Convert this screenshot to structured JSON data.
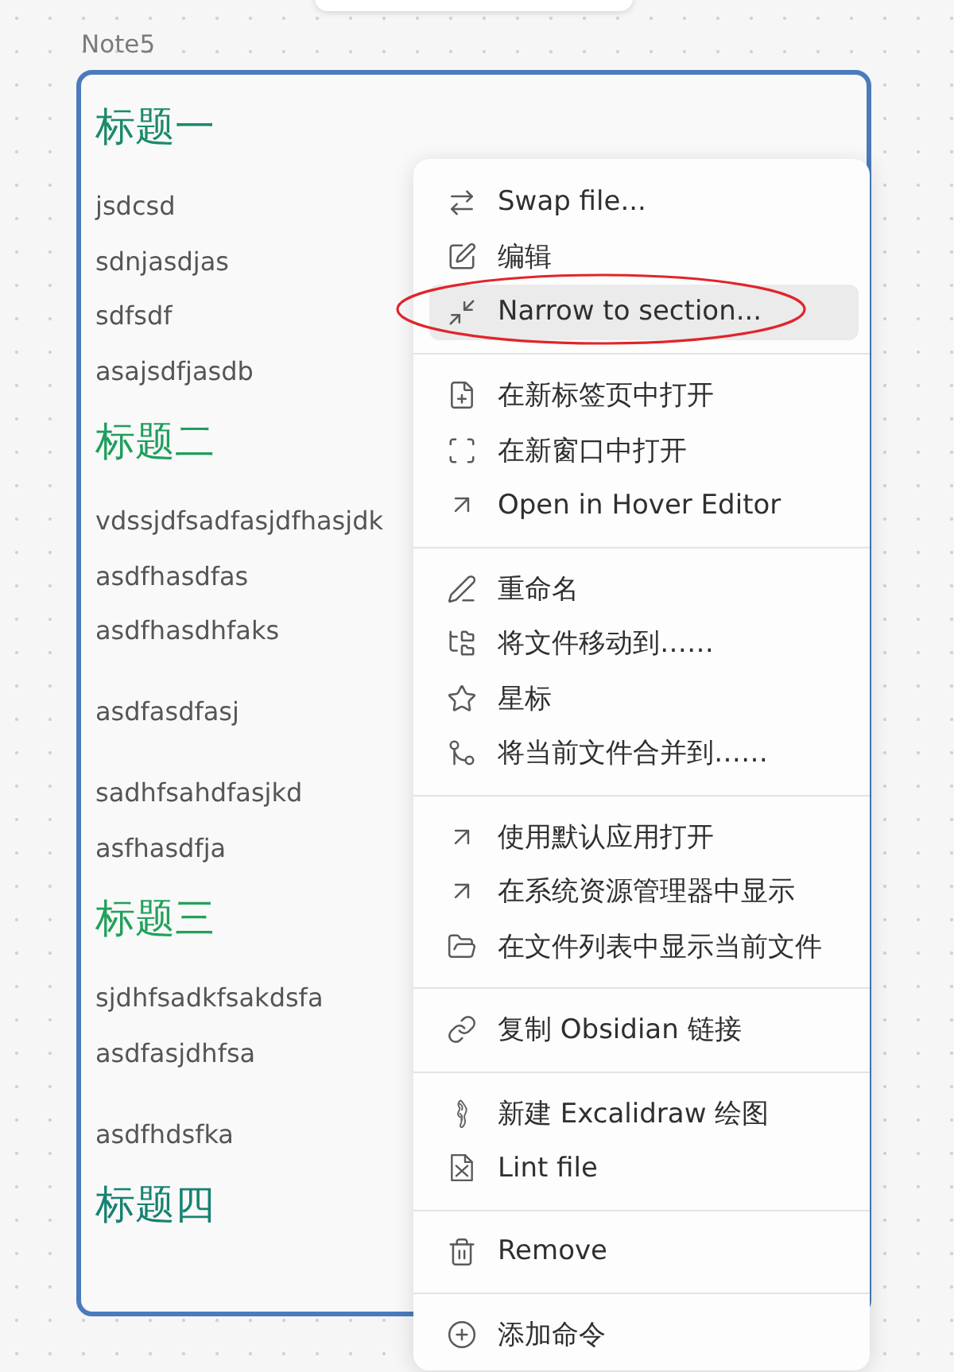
{
  "note": {
    "title": "Note5",
    "blocks": [
      {
        "kind": "heading",
        "text": "标题一",
        "color": "#1b8a6b"
      },
      {
        "kind": "paragraph",
        "lines": [
          "jsdcsd",
          "sdnjasdjas",
          "sdfsdf",
          "asajsdfjasdb"
        ]
      },
      {
        "kind": "heading",
        "text": "标题二",
        "color": "#1f9e5c"
      },
      {
        "kind": "paragraph",
        "lines": [
          "vdssjdfsadfasjdfhasjdk",
          "asdfhasdfas",
          "asdfhasdhfaks"
        ]
      },
      {
        "kind": "paragraph",
        "lines": [
          "asdfasdfasj"
        ]
      },
      {
        "kind": "paragraph",
        "lines": [
          "sadhfsahdfasjkd",
          "asfhasdfja"
        ]
      },
      {
        "kind": "heading",
        "text": "标题三",
        "color": "#22a15b"
      },
      {
        "kind": "paragraph",
        "lines": [
          "sjdhfsadkfsakdsfa",
          "asdfasjdhfsa"
        ]
      },
      {
        "kind": "paragraph",
        "lines": [
          "asdfhdsfka"
        ]
      },
      {
        "kind": "heading",
        "text": "标题四",
        "color": "#178270"
      }
    ]
  },
  "context_menu": {
    "groups": [
      {
        "items": [
          {
            "label": "Swap file...",
            "selected": false,
            "circled": false
          },
          {
            "label": "编辑",
            "selected": false,
            "circled": false
          },
          {
            "label": "Narrow to section...",
            "selected": true,
            "circled": true
          }
        ]
      },
      {
        "items": [
          {
            "label": "在新标签页中打开",
            "selected": false,
            "circled": false
          },
          {
            "label": "在新窗口中打开",
            "selected": false,
            "circled": false
          },
          {
            "label": "Open in Hover Editor",
            "selected": false,
            "circled": false
          }
        ]
      },
      {
        "items": [
          {
            "label": "重命名",
            "selected": false,
            "circled": false
          },
          {
            "label": "将文件移动到……",
            "selected": false,
            "circled": false
          },
          {
            "label": "星标",
            "selected": false,
            "circled": false
          },
          {
            "label": "将当前文件合并到……",
            "selected": false,
            "circled": false
          }
        ]
      },
      {
        "items": [
          {
            "label": "使用默认应用打开",
            "selected": false,
            "circled": false
          },
          {
            "label": "在系统资源管理器中显示",
            "selected": false,
            "circled": false
          },
          {
            "label": "在文件列表中显示当前文件",
            "selected": false,
            "circled": false
          }
        ]
      },
      {
        "items": [
          {
            "label": "复制 Obsidian 链接",
            "selected": false,
            "circled": false
          }
        ]
      },
      {
        "items": [
          {
            "label": "新建 Excalidraw 绘图",
            "selected": false,
            "circled": false
          },
          {
            "label": "Lint file",
            "selected": false,
            "circled": false
          }
        ]
      },
      {
        "items": [
          {
            "label": "Remove",
            "selected": false,
            "circled": false
          }
        ]
      },
      {
        "items": [
          {
            "label": "添加命令",
            "selected": false,
            "circled": false
          }
        ]
      }
    ]
  }
}
